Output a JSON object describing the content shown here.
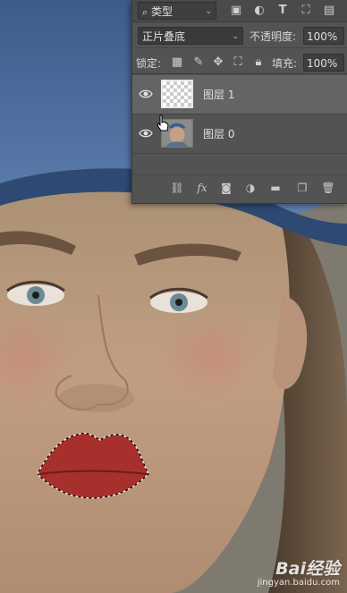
{
  "layers_panel": {
    "filter": {
      "kind_label": "类型",
      "icons": [
        "image-filter-icon",
        "adjustment-filter-icon",
        "type-filter-icon",
        "shape-filter-icon",
        "smart-object-filter-icon"
      ]
    },
    "blend_mode": "正片叠底",
    "opacity_label": "不透明度:",
    "opacity_value": "100%",
    "lock_label": "锁定:",
    "fill_label": "填充:",
    "fill_value": "100%",
    "layers": [
      {
        "name": "图层 1",
        "visible": true,
        "selected": true,
        "thumbnail": "transparent"
      },
      {
        "name": "图层 0",
        "visible": true,
        "selected": false,
        "thumbnail": "photo"
      }
    ],
    "bottom_icons": [
      "link-icon",
      "fx-icon",
      "mask-icon",
      "adjustment-icon",
      "folder-icon",
      "new-layer-icon",
      "trash-icon"
    ]
  },
  "watermark": {
    "brand": "Bai经验",
    "url": "jingyan.baidu.com"
  },
  "colors": {
    "panel_bg": "#535353",
    "selected_layer": "#646464",
    "lip_color": "#a8302c"
  }
}
